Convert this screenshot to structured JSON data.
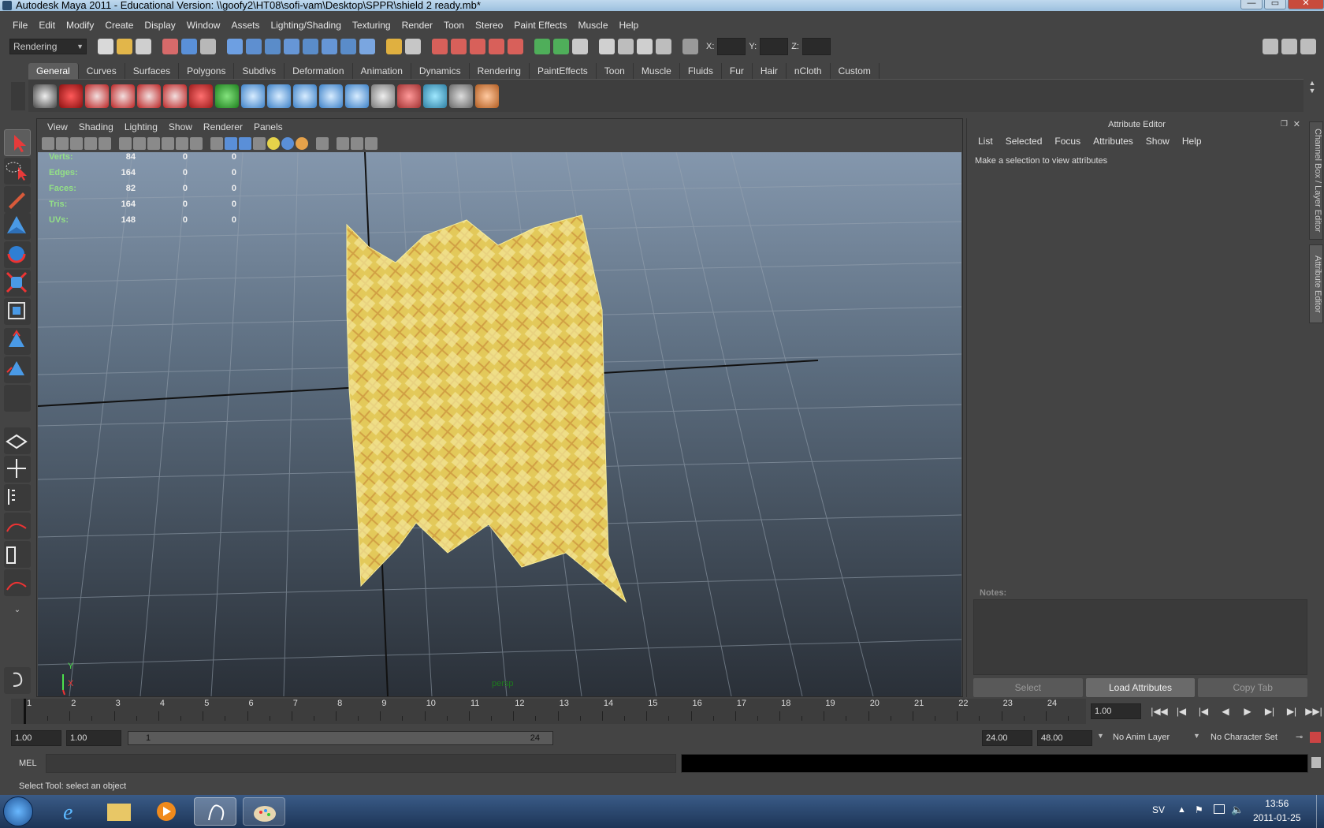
{
  "window": {
    "title": "Autodesk Maya 2011 - Educational Version: \\\\goofy2\\HT08\\sofi-vam\\Desktop\\SPPR\\shield 2 ready.mb*"
  },
  "menus": [
    "File",
    "Edit",
    "Modify",
    "Create",
    "Display",
    "Window",
    "Assets",
    "Lighting/Shading",
    "Texturing",
    "Render",
    "Toon",
    "Stereo",
    "Paint Effects",
    "Muscle",
    "Help"
  ],
  "mode": "Rendering",
  "xyz": {
    "x": "X:",
    "y": "Y:",
    "z": "Z:"
  },
  "shelf_tabs": [
    "General",
    "Curves",
    "Surfaces",
    "Polygons",
    "Subdivs",
    "Deformation",
    "Animation",
    "Dynamics",
    "Rendering",
    "PaintEffects",
    "Toon",
    "Muscle",
    "Fluids",
    "Fur",
    "Hair",
    "nCloth",
    "Custom"
  ],
  "viewport": {
    "menus": [
      "View",
      "Shading",
      "Lighting",
      "Show",
      "Renderer",
      "Panels"
    ],
    "hud": [
      {
        "label": "Verts:",
        "a": "84",
        "b": "0",
        "c": "0"
      },
      {
        "label": "Edges:",
        "a": "164",
        "b": "0",
        "c": "0"
      },
      {
        "label": "Faces:",
        "a": "82",
        "b": "0",
        "c": "0"
      },
      {
        "label": "Tris:",
        "a": "164",
        "b": "0",
        "c": "0"
      },
      {
        "label": "UVs:",
        "a": "148",
        "b": "0",
        "c": "0"
      }
    ],
    "camera": "persp",
    "axis_y": "Y",
    "axis_x": "X"
  },
  "attribute_editor": {
    "title": "Attribute Editor",
    "menus": [
      "List",
      "Selected",
      "Focus",
      "Attributes",
      "Show",
      "Help"
    ],
    "hint": "Make a selection to view attributes",
    "notes_label": "Notes:",
    "buttons": [
      "Select",
      "Load Attributes",
      "Copy Tab"
    ]
  },
  "side_tabs": {
    "channel": "Channel Box / Layer Editor",
    "attr": "Attribute Editor"
  },
  "timeline": {
    "ticks": [
      "1",
      "2",
      "3",
      "4",
      "5",
      "6",
      "7",
      "8",
      "9",
      "10",
      "11",
      "12",
      "13",
      "14",
      "15",
      "16",
      "17",
      "18",
      "19",
      "20",
      "21",
      "22",
      "23",
      "24"
    ],
    "current": "1.00"
  },
  "playback": [
    "|◀◀",
    "|◀",
    "|◀",
    "◀",
    "▶",
    "▶|",
    "▶|",
    "▶▶|"
  ],
  "range": {
    "start": "1.00",
    "start2": "1.00",
    "bar_start": "1",
    "bar_end": "24",
    "end": "24.00",
    "end2": "48.00",
    "anim_layer": "No Anim Layer",
    "char_set": "No Character Set"
  },
  "command": {
    "mel": "MEL"
  },
  "help_line": "Select Tool: select an object",
  "taskbar": {
    "lang": "SV",
    "time": "13:56",
    "date": "2011-01-25"
  }
}
